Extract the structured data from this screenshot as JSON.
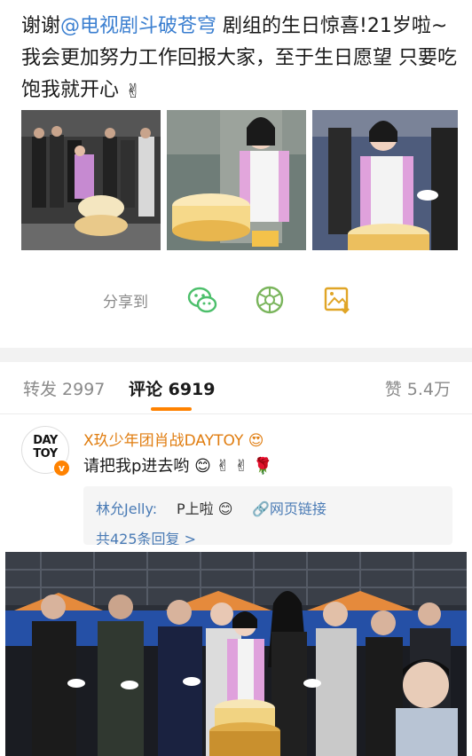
{
  "post": {
    "text_prefix": "谢谢",
    "mention": "@电视剧斗破苍穹",
    "text_body": " 剧组的生日惊喜!21岁啦~我会更加努力工作回报大家，至于生日愿望       只要吃饱我就开心",
    "emoji": "✌"
  },
  "share": {
    "label": "分享到",
    "icons": [
      "wechat-icon",
      "moments-icon",
      "save-image-icon"
    ],
    "colors": {
      "wechat": "#4cbf6b",
      "moments": "#7ab55c",
      "save": "#e0a526"
    }
  },
  "tabs": {
    "repost": "转发 2997",
    "comment": "评论 6919",
    "like": "赞 5.4万",
    "accent": "#ff8200"
  },
  "comment": {
    "avatar_text_1": "DAY",
    "avatar_text_2": "TOY",
    "badge": "v",
    "username": "X玖少年团肖战DAYTOY",
    "text": "请把我p进去哟",
    "emojis": "😊 ✌ ✌ 🌹",
    "reply": {
      "user": "林允Jelly:",
      "text": "P上啦",
      "link": "网页链接",
      "count": "共425条回复 >"
    }
  }
}
